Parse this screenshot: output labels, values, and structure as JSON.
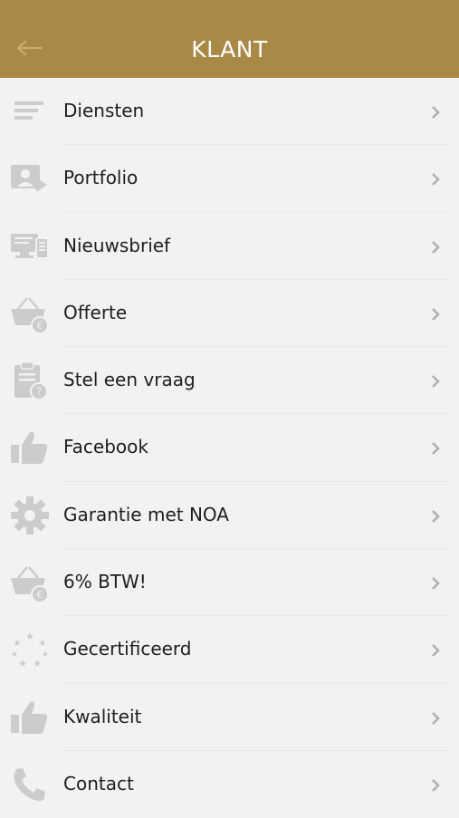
{
  "header": {
    "title": "KLANT",
    "background": "#a98945",
    "back_icon": "arrow-left-icon"
  },
  "menu": {
    "items": [
      {
        "label": "Diensten",
        "icon": "list-lines-icon"
      },
      {
        "label": "Portfolio",
        "icon": "portfolio-user-icon"
      },
      {
        "label": "Nieuwsbrief",
        "icon": "newsletter-devices-icon"
      },
      {
        "label": "Offerte",
        "icon": "basket-euro-icon"
      },
      {
        "label": "Stel een vraag",
        "icon": "clipboard-question-icon"
      },
      {
        "label": "Facebook",
        "icon": "thumbs-up-icon"
      },
      {
        "label": "Garantie met NOA",
        "icon": "gear-icon"
      },
      {
        "label": "6% BTW!",
        "icon": "basket-euro-icon"
      },
      {
        "label": "Gecertificeerd",
        "icon": "stars-icon"
      },
      {
        "label": "Kwaliteit",
        "icon": "thumbs-up-icon"
      },
      {
        "label": "Contact",
        "icon": "phone-icon"
      }
    ],
    "icon_color": "#cccccc",
    "chevron_color": "#b0b0b0"
  }
}
